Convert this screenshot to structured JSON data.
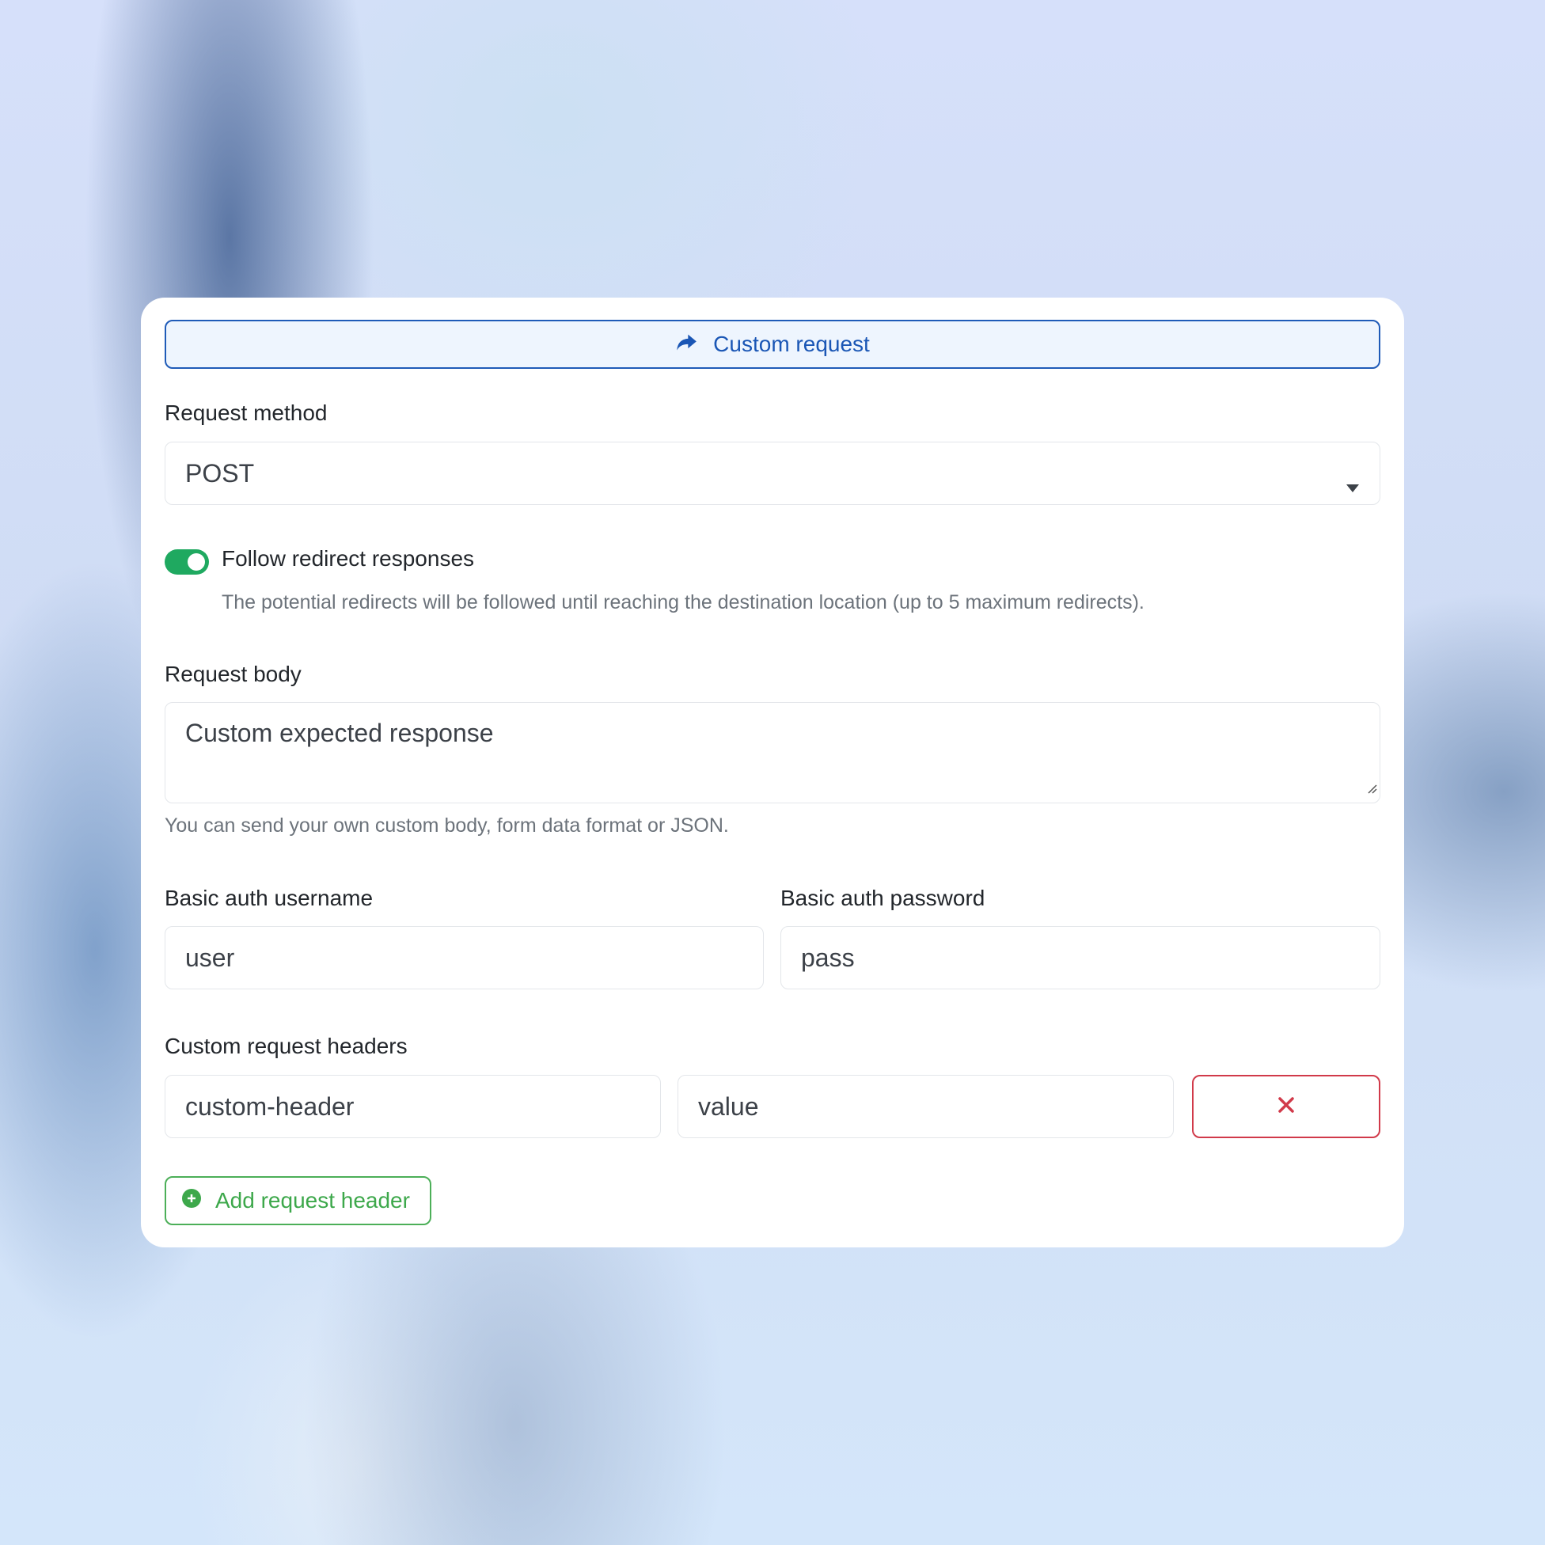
{
  "custom_request_button": {
    "label": "Custom request",
    "icon": "share-arrow-icon"
  },
  "request_method": {
    "label": "Request method",
    "value": "POST"
  },
  "follow_redirects": {
    "label": "Follow redirect responses",
    "enabled": true,
    "help": "The potential redirects will be followed until reaching the destination location (up to 5 maximum redirects)."
  },
  "request_body": {
    "label": "Request body",
    "value": "Custom expected response",
    "help": "You can send your own custom body, form data format or JSON."
  },
  "basic_auth": {
    "username_label": "Basic auth username",
    "username_value": "user",
    "password_label": "Basic auth password",
    "password_value": "pass"
  },
  "custom_headers": {
    "label": "Custom request headers",
    "rows": [
      {
        "name": "custom-header",
        "value": "value"
      }
    ],
    "add_label": "Add request header"
  },
  "colors": {
    "primary": "#1a56b5",
    "toggle_on": "#1fa960",
    "danger": "#d13a4a",
    "success": "#3da84b"
  }
}
